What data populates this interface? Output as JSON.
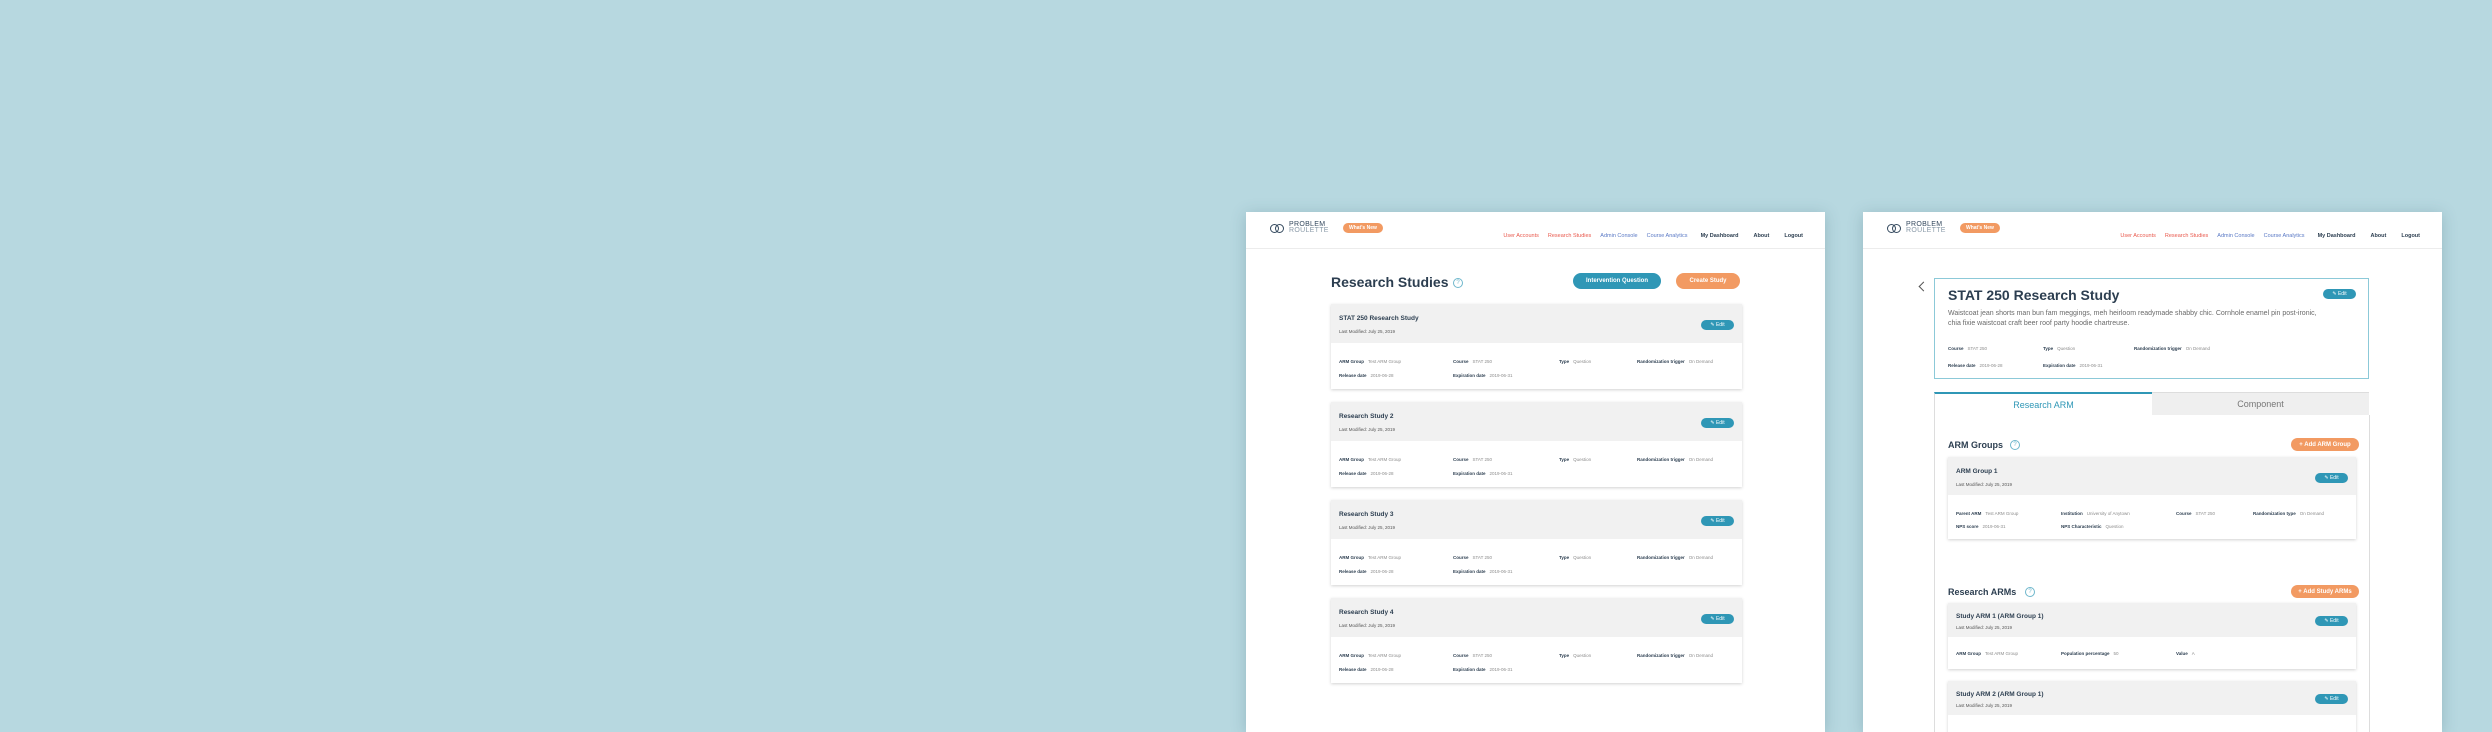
{
  "brand": {
    "line1": "PROBLEM",
    "line2": "ROULETTE",
    "badge": "What's New"
  },
  "nav": [
    {
      "label": "User Accounts",
      "style": "red"
    },
    {
      "label": "Research Studies",
      "style": "red"
    },
    {
      "label": "Admin Console",
      "style": "blue"
    },
    {
      "label": "Course Analytics",
      "style": "blue"
    },
    {
      "label": "My Dashboard",
      "style": "dark"
    },
    {
      "label": "About",
      "style": "dark"
    },
    {
      "label": "Logout",
      "style": "dark"
    }
  ],
  "colors": {
    "background": "#b7d8e0",
    "primary": "#2f97b6",
    "accent": "#f29a62",
    "nav_red": "#e9594d",
    "nav_blue": "#5a79c5"
  },
  "studies_page": {
    "title": "Research Studies",
    "help": "?",
    "intervention_button": "Intervention Question",
    "create_button": "Create Study",
    "edit_label": "✎ Edit",
    "studies": [
      {
        "title": "STAT 250 Research Study",
        "modified": "Last Modified: July 25, 2019",
        "arm_group_label": "ARM Group",
        "arm_group": "Test ARM Group",
        "course_label": "Course",
        "course": "STAT 250",
        "type_label": "Type",
        "type": "Question",
        "trigger_label": "Randomization trigger",
        "trigger": "On Demand",
        "release_label": "Release date",
        "release": "2019-06-28",
        "expiration_label": "Expiration date",
        "expiration": "2019-06-31"
      },
      {
        "title": "Research Study 2",
        "modified": "Last Modified: July 25, 2019",
        "arm_group_label": "ARM Group",
        "arm_group": "Test ARM Group",
        "course_label": "Course",
        "course": "STAT 250",
        "type_label": "Type",
        "type": "Question",
        "trigger_label": "Randomization trigger",
        "trigger": "On Demand",
        "release_label": "Release date",
        "release": "2019-06-28",
        "expiration_label": "Expiration date",
        "expiration": "2019-06-31"
      },
      {
        "title": "Research Study 3",
        "modified": "Last Modified: July 25, 2019",
        "arm_group_label": "ARM Group",
        "arm_group": "Test ARM Group",
        "course_label": "Course",
        "course": "STAT 250",
        "type_label": "Type",
        "type": "Question",
        "trigger_label": "Randomization trigger",
        "trigger": "On Demand",
        "release_label": "Release date",
        "release": "2019-06-28",
        "expiration_label": "Expiration date",
        "expiration": "2019-06-31"
      },
      {
        "title": "Research Study 4",
        "modified": "Last Modified: July 25, 2019",
        "arm_group_label": "ARM Group",
        "arm_group": "Test ARM Group",
        "course_label": "Course",
        "course": "STAT 250",
        "type_label": "Type",
        "type": "Question",
        "trigger_label": "Randomization trigger",
        "trigger": "On Demand",
        "release_label": "Release date",
        "release": "2019-06-28",
        "expiration_label": "Expiration date",
        "expiration": "2019-06-31"
      }
    ]
  },
  "detail_page": {
    "title": "STAT 250 Research Study",
    "edit_label": "✎ Edit",
    "description": "Waistcoat jean shorts man bun fam meggings, meh heirloom readymade shabby chic. Cornhole enamel pin post-ironic, chia fixie waistcoat craft beer roof party hoodie chartreuse.",
    "meta": {
      "course_label": "Course",
      "course": "STAT 250",
      "type_label": "Type",
      "type": "Question",
      "trigger_label": "Randomization trigger",
      "trigger": "On Demand",
      "release_label": "Release date",
      "release": "2019-06-28",
      "expiration_label": "Expiration date",
      "expiration": "2019-06-31"
    },
    "tabs": {
      "active": "Research ARM",
      "inactive": "Component"
    },
    "arm_groups": {
      "title": "ARM Groups",
      "help": "?",
      "add_button": "+ Add ARM Group",
      "items": [
        {
          "title": "ARM Group 1",
          "modified": "Last Modified: July 25, 2019",
          "parent_label": "Parent ARM",
          "parent": "Test ARM Group",
          "institution_label": "Institution",
          "institution": "University of Anytown",
          "course_label": "Course",
          "course": "STAT 250",
          "randomization_label": "Randomization type",
          "randomization": "On Demand",
          "nps_score_label": "NPS score",
          "nps_score": "2019-06-31",
          "nps_char_label": "NPS Characteristic",
          "nps_char": "Question"
        }
      ]
    },
    "research_arms": {
      "title": "Research ARMs",
      "help": "?",
      "add_button": "+ Add Study ARMs",
      "items": [
        {
          "title": "Study ARM 1 (ARM Group 1)",
          "modified": "Last Modified: July 25, 2019",
          "arm_group_label": "ARM Group",
          "arm_group": "Test ARM Group",
          "population_label": "Population percentage",
          "population": "50",
          "value_label": "Value",
          "value": "A"
        },
        {
          "title": "Study ARM 2 (ARM Group 1)",
          "modified": "Last Modified: July 25, 2019"
        }
      ]
    }
  }
}
